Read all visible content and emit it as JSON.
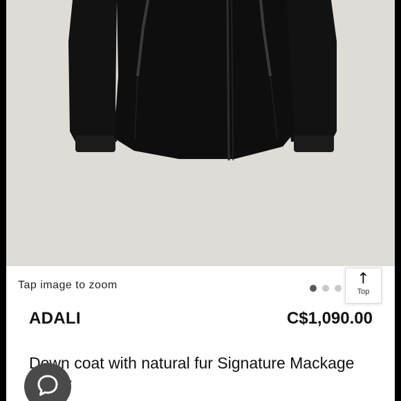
{
  "product": {
    "zoom_hint": "Tap image to zoom",
    "name": "ADALI",
    "price": "C$1,090.00",
    "description": "Down coat with natural fur Signature Mackage",
    "description_cont": "r"
  },
  "carousel": {
    "slide_count": 6,
    "active_index": 0
  },
  "top_button": {
    "label": "Top",
    "icon": "arrow-up-icon"
  },
  "chat_button": {
    "icon": "chat-bubble-icon"
  },
  "colors": {
    "hero_background": "#dfdcd8",
    "coat": "#111111",
    "chat_button": "#4a4a4a",
    "dot_active": "#5a5a5a",
    "dot_inactive": "#c9c9c9"
  }
}
